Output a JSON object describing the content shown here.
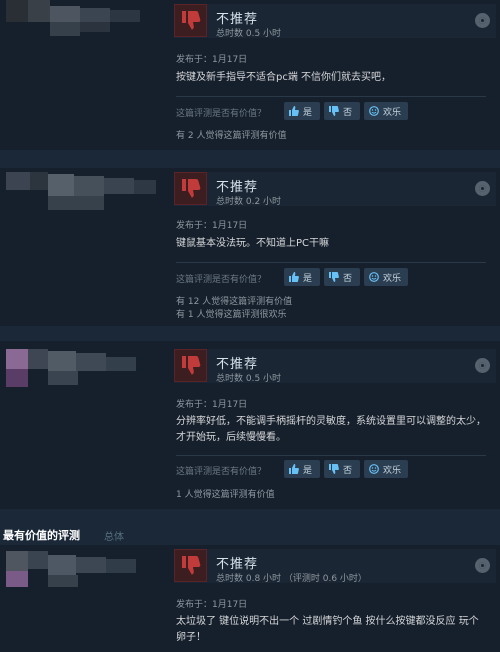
{
  "reviews": [
    {
      "verdict": "不推荐",
      "hours": "总时数 0.5 小时",
      "posted": "发布于：1月17日",
      "text": "按键及新手指导不适合pc端 不信你们就去买吧，",
      "helpful_question": "这篇评测是否有价值？",
      "yes": "是",
      "no": "否",
      "funny": "欢乐",
      "helpful_counts": [
        "有 2 人觉得这篇评测有价值"
      ]
    },
    {
      "verdict": "不推荐",
      "hours": "总时数 0.2 小时",
      "posted": "发布于：1月17日",
      "text": "键鼠基本没法玩。不知道上PC干嘛",
      "helpful_question": "这篇评测是否有价值？",
      "yes": "是",
      "no": "否",
      "funny": "欢乐",
      "helpful_counts": [
        "有 12 人觉得这篇评测有价值",
        "有 1 人觉得这篇评测很欢乐"
      ]
    },
    {
      "verdict": "不推荐",
      "hours": "总时数 0.5 小时",
      "posted": "发布于：1月17日",
      "text": "分辨率好低，不能调手柄摇杆的灵敏度，系统设置里可以调整的太少，才开始玩，后续慢慢看。",
      "helpful_question": "这篇评测是否有价值？",
      "yes": "是",
      "no": "否",
      "funny": "欢乐",
      "helpful_counts": [
        "1 人觉得这篇评测有价值"
      ]
    },
    {
      "verdict": "不推荐",
      "hours": "总时数 0.8 小时 （评测时 0.6 小时）",
      "posted": "发布于：1月17日",
      "text": "太垃圾了 键位说明不出一个 过剧情钓个鱼 按什么按键都没反应 玩个卵子！"
    }
  ],
  "section": {
    "title": "最有价值的评测",
    "subtitle": "总体"
  },
  "colors": {
    "background": "#1b2838",
    "card": "#16202d",
    "thumb_down_red": "#c23b3b",
    "button": "#2b3e51"
  }
}
